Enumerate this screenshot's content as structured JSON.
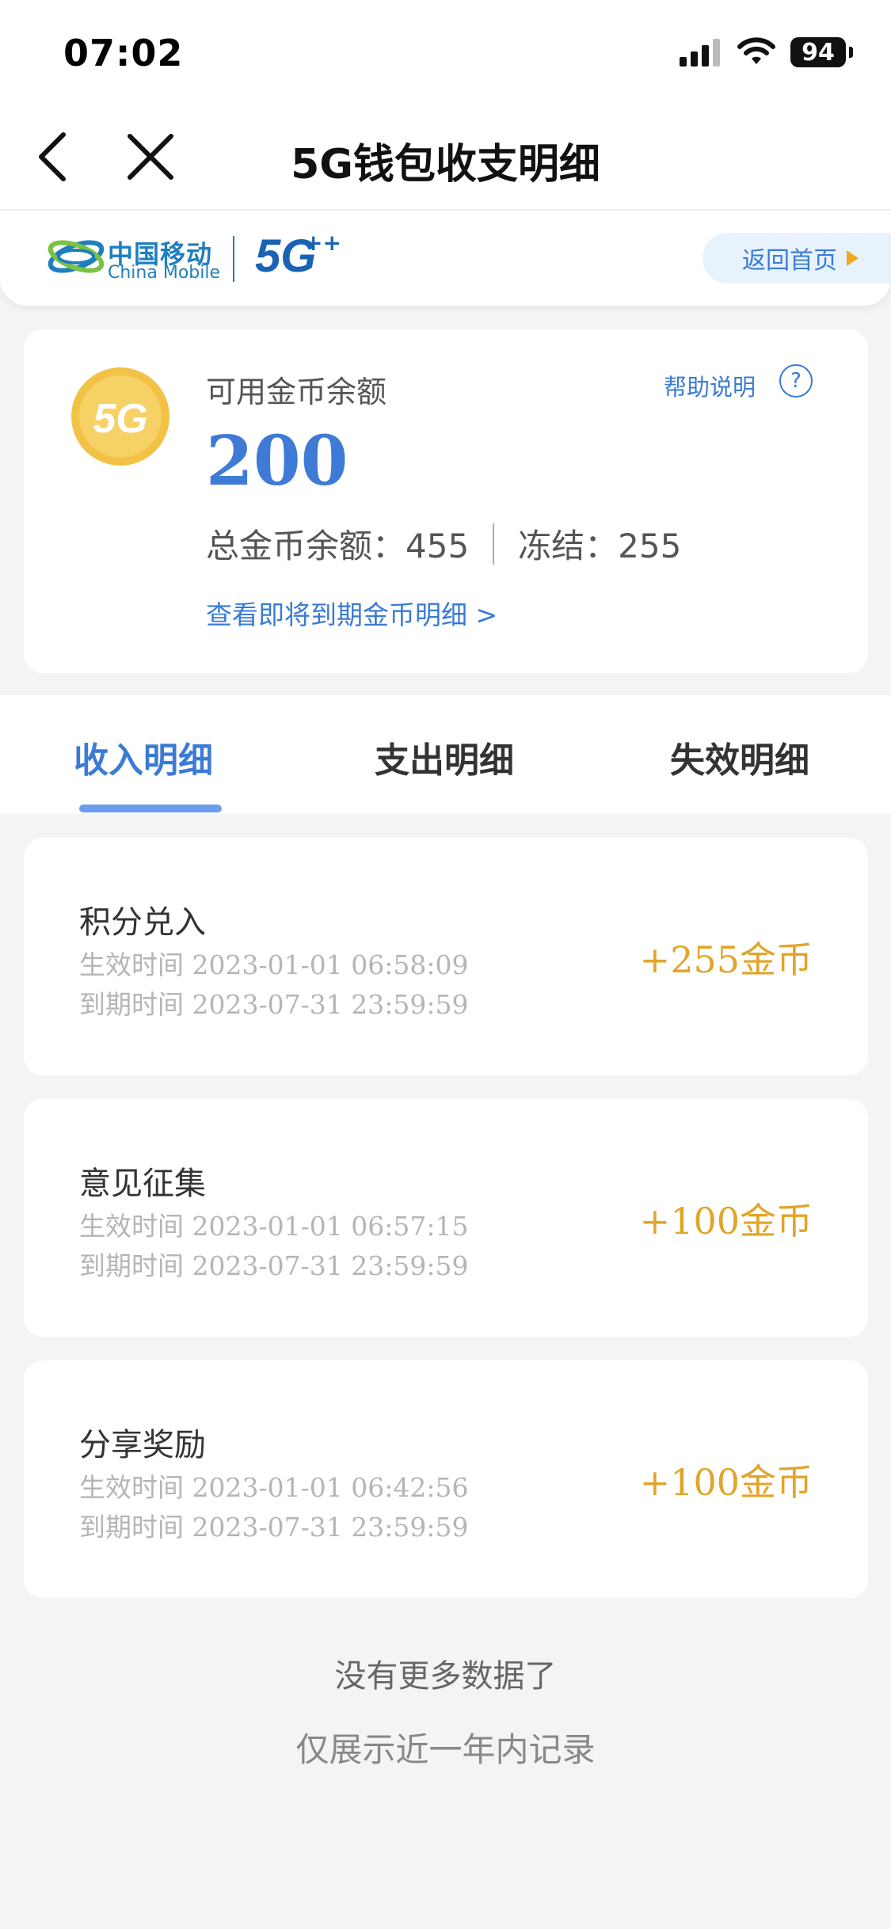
{
  "status_bar": {
    "time": "07:02",
    "battery": "94"
  },
  "nav": {
    "title": "5G钱包收支明细"
  },
  "brand": {
    "name_cn": "中国移动",
    "name_en": "China Mobile",
    "badge": "5G",
    "badge_sup": "++",
    "home_label": "返回首页"
  },
  "balance": {
    "label": "可用金币余额",
    "help_label": "帮助说明",
    "help_icon": "?",
    "value": "200",
    "total_label": "总金币余额：455",
    "frozen_label": "冻结：255",
    "expiring_link": "查看即将到期金币明细 >",
    "coin_text": "5G"
  },
  "tabs": [
    {
      "label": "收入明细",
      "active": true
    },
    {
      "label": "支出明细",
      "active": false
    },
    {
      "label": "失效明细",
      "active": false
    }
  ],
  "records": [
    {
      "title": "积分兑入",
      "effective": "生效时间 2023-01-01 06:58:09",
      "expire": "到期时间 2023-07-31 23:59:59",
      "amount": "+255金币"
    },
    {
      "title": "意见征集",
      "effective": "生效时间 2023-01-01 06:57:15",
      "expire": "到期时间 2023-07-31 23:59:59",
      "amount": "+100金币"
    },
    {
      "title": "分享奖励",
      "effective": "生效时间 2023-01-01 06:42:56",
      "expire": "到期时间 2023-07-31 23:59:59",
      "amount": "+100金币"
    }
  ],
  "footer": {
    "no_more": "没有更多数据了",
    "note": "仅展示近一年内记录"
  },
  "colors": {
    "accent": "#3a7bd5",
    "gold": "#e0a52a",
    "brand_blue": "#1f7fbe"
  }
}
